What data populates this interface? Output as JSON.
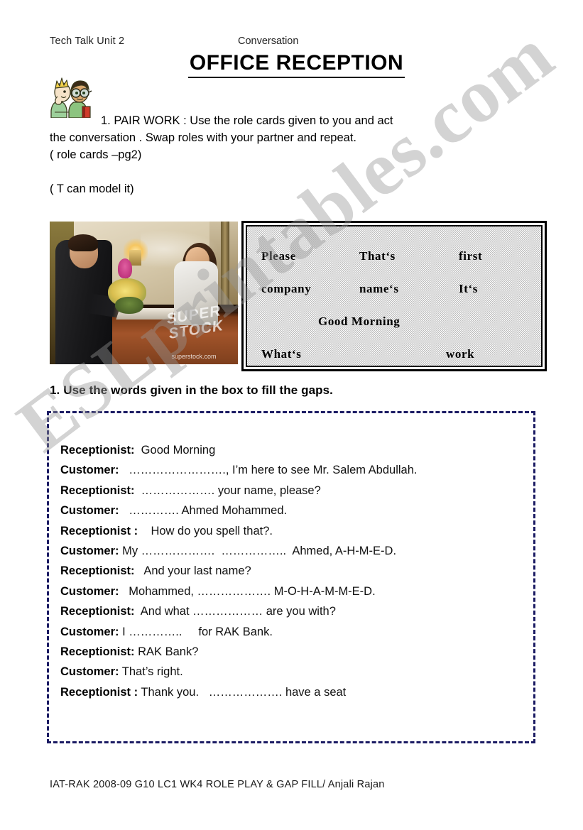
{
  "header": {
    "unit_label": "Tech Talk Unit 2",
    "section_label": "Conversation",
    "title": "OFFICE RECEPTION"
  },
  "instructions": {
    "line1": "1. PAIR WORK : Use the role cards given to you and act",
    "line2": "the conversation . Swap roles with your partner and repeat.",
    "line3": "( role cards –pg2)",
    "line4": "( T can model it)"
  },
  "photo": {
    "alt": "Businessman speaking with a receptionist at an office reception desk",
    "watermark_brand": "SUPER STOCK",
    "watermark_url": "superstock.com"
  },
  "word_box": {
    "rows": [
      {
        "col1": "Please",
        "col2": "That‘s",
        "col3": "first"
      },
      {
        "col1": "company",
        "col2": "name‘s",
        "col3": "It‘s"
      }
    ],
    "center_word": "Good Morning",
    "last_row": {
      "left": "What‘s",
      "right": "work"
    }
  },
  "exercise": {
    "heading": "1. Use the words given in the box to fill the gaps."
  },
  "dialogue": {
    "lines": [
      {
        "speaker": "Receptionist:",
        "text": "  Good Morning"
      },
      {
        "speaker": "Customer:",
        "text": "   ……………………., I’m here to see Mr. Salem Abdullah."
      },
      {
        "speaker": "Receptionist:",
        "text": "  ………………. your name, please?"
      },
      {
        "speaker": "Customer:",
        "text": "   …………. Ahmed Mohammed."
      },
      {
        "speaker": "Receptionist :",
        "text": "    How do you spell that?."
      },
      {
        "speaker": "Customer:",
        "text": " My ……………….  ……………..  Ahmed, A-H-M-E-D."
      },
      {
        "speaker": "Receptionist:",
        "text": "   And your last name?"
      },
      {
        "speaker": "Customer:",
        "text": "   Mohammed, ………………. M-O-H-A-M-M-E-D."
      },
      {
        "speaker": "Receptionist:",
        "text": "  And what ……………… are you with?"
      },
      {
        "speaker": "Customer:",
        "text": " I …………..     for RAK Bank."
      },
      {
        "speaker": "Receptionist:",
        "text": " RAK Bank?"
      },
      {
        "speaker": "Customer:",
        "text": " That’s right."
      },
      {
        "speaker": "Receptionist :",
        "text": " Thank you.   ………………. have a seat"
      }
    ]
  },
  "footer": {
    "text": "IAT-RAK 2008-09 G10 LC1 WK4 ROLE PLAY & GAP FILL/ Anjali Rajan"
  },
  "watermark": {
    "text": "ESLprintables.com"
  },
  "colors": {
    "dialogue_border": "#1b1b63",
    "wordbox_border": "#000000",
    "wordbox_fill": "#bdbdbd",
    "text": "#000000",
    "page_background": "#ffffff"
  }
}
